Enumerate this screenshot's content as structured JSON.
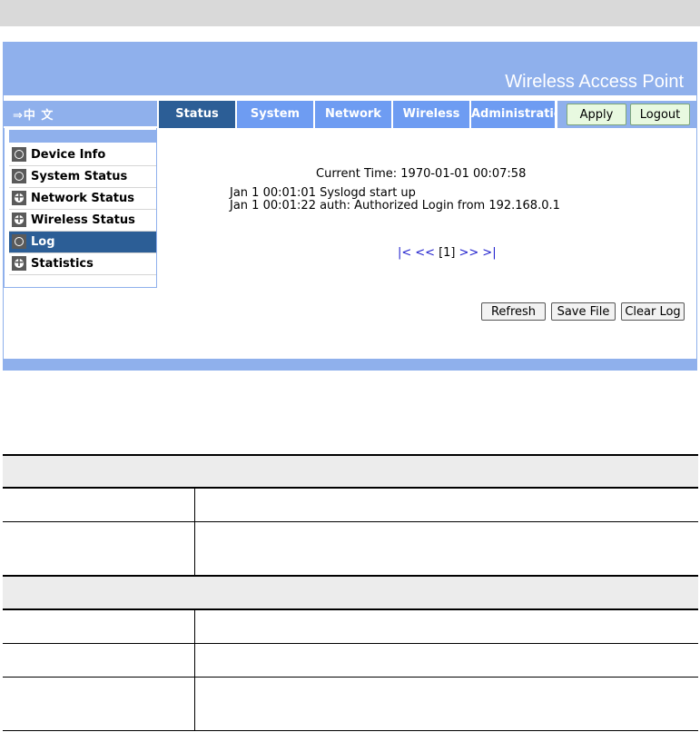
{
  "banner": {
    "title": "Wireless Access Point"
  },
  "language_link": "⇒中 文",
  "tabs": [
    {
      "label": "Status"
    },
    {
      "label": "System"
    },
    {
      "label": "Network"
    },
    {
      "label": "Wireless"
    },
    {
      "label": "Administration"
    }
  ],
  "actions": {
    "apply": "Apply",
    "logout": "Logout"
  },
  "sidebar": {
    "items": [
      {
        "label": "Device Info",
        "icon": "circle-icon"
      },
      {
        "label": "System Status",
        "icon": "circle-icon"
      },
      {
        "label": "Network Status",
        "icon": "plus-icon"
      },
      {
        "label": "Wireless Status",
        "icon": "plus-icon"
      },
      {
        "label": "Log",
        "icon": "circle-icon"
      },
      {
        "label": "Statistics",
        "icon": "plus-icon"
      }
    ]
  },
  "log": {
    "current_time": "Current Time: 1970-01-01 00:07:58",
    "entries": [
      "Jan 1 00:01:01 Syslogd start up",
      "Jan 1 00:01:22 auth: Authorized Login from 192.168.0.1"
    ],
    "pager": {
      "first": "|<",
      "prev": "<<",
      "current": "[1]",
      "next": ">>",
      "last": ">|"
    },
    "buttons": {
      "refresh": "Refresh",
      "save": "Save File",
      "clear": "Clear Log"
    }
  },
  "colors": {
    "banner": "#8fb0ec",
    "tab": "#6e9cf2",
    "tab_active": "#2c5e96",
    "link": "#1d1dcc"
  }
}
